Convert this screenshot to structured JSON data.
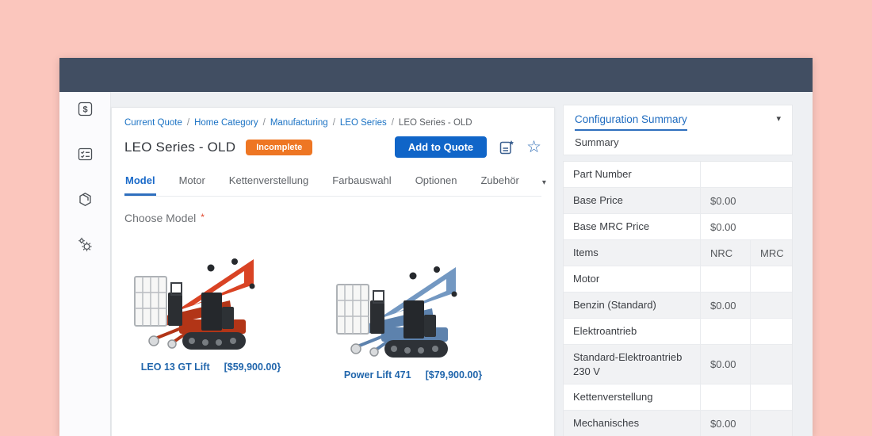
{
  "colors": {
    "frame_background": "#fbc6bd",
    "topbar": "#414e62",
    "accent_blue": "#1a6ac9",
    "button_blue": "#1065c8",
    "badge_orange": "#ee7623",
    "required_red": "#e0482e",
    "row_shade": "#f1f2f4"
  },
  "icons": {
    "favorite_star": "☆",
    "tabs_overflow_caret": "▾",
    "panel_caret": "▾"
  },
  "sidebar": {
    "items": [
      {
        "name": "quote-dollar-icon"
      },
      {
        "name": "checklist-icon"
      },
      {
        "name": "products-package-icon"
      },
      {
        "name": "settings-gears-icon"
      }
    ]
  },
  "main": {
    "breadcrumb": {
      "separator": "/",
      "items": [
        "Current Quote",
        "Home Category",
        "Manufacturing",
        "LEO Series"
      ],
      "current": "LEO Series - OLD"
    },
    "title": "LEO Series - OLD",
    "status_badge": "Incomplete",
    "add_to_quote_label": "Add to Quote",
    "tabs": [
      "Model",
      "Motor",
      "Kettenverstellung",
      "Farbauswahl",
      "Optionen",
      "Zubehör"
    ],
    "active_tab": "Model",
    "section_title": "Choose Model",
    "required_marker": "*",
    "products": [
      {
        "name": "LEO 13 GT Lift",
        "price": "[$59,900.00}",
        "colors": {
          "main": "#d94324",
          "dark": "#b23517"
        }
      },
      {
        "name": "Power Lift 471",
        "price": "[$79,900.00}",
        "colors": {
          "main": "#7398c2",
          "dark": "#5d82ad"
        }
      }
    ]
  },
  "summary_panel": {
    "tab_label": "Configuration Summary",
    "subtitle": "Summary",
    "rows": [
      {
        "label": "Part Number",
        "value": ""
      },
      {
        "label": "Base Price",
        "value": "$0.00"
      },
      {
        "label": "Base MRC Price",
        "value": "$0.00"
      },
      {
        "label": "Items",
        "nrc": "NRC",
        "mrc": "MRC"
      },
      {
        "label": "Motor",
        "nrc": "",
        "mrc": ""
      },
      {
        "label": "Benzin (Standard)",
        "nrc": "$0.00",
        "mrc": ""
      },
      {
        "label": "Elektroantrieb",
        "nrc": "",
        "mrc": ""
      },
      {
        "label": "Standard-Elektroantrieb 230 V",
        "nrc": "$0.00",
        "mrc": ""
      },
      {
        "label": "Kettenverstellung",
        "nrc": "",
        "mrc": ""
      },
      {
        "label": "Mechanisches",
        "nrc": "$0.00",
        "mrc": ""
      }
    ]
  }
}
